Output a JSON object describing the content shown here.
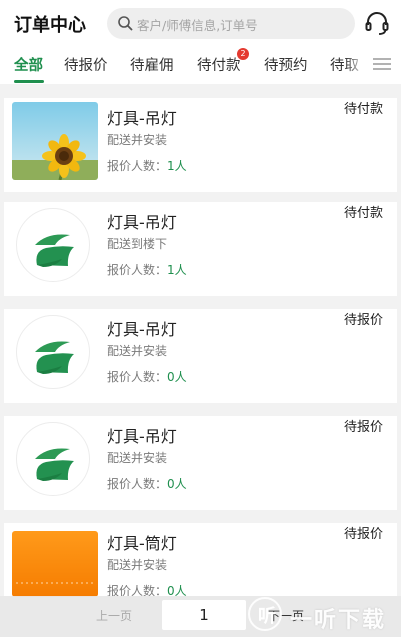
{
  "header": {
    "title": "订单中心",
    "search_placeholder": "客户/师傅信息,订单号"
  },
  "tabs": [
    {
      "label": "全部",
      "active": true
    },
    {
      "label": "待报价"
    },
    {
      "label": "待雇佣"
    },
    {
      "label": "待付款",
      "badge": "2"
    },
    {
      "label": "待预约"
    },
    {
      "label": "待取"
    }
  ],
  "quote_label": "报价人数：",
  "orders": [
    {
      "name": "灯具-吊灯",
      "service": "配送并安装",
      "quote_count": "1人",
      "status": "待付款",
      "thumb": "sunflower-photo"
    },
    {
      "name": "灯具-吊灯",
      "service": "配送到楼下",
      "quote_count": "1人",
      "status": "待付款",
      "thumb": "app-logo"
    },
    {
      "name": "灯具-吊灯",
      "service": "配送并安装",
      "quote_count": "0人",
      "status": "待报价",
      "thumb": "app-logo"
    },
    {
      "name": "灯具-吊灯",
      "service": "配送并安装",
      "quote_count": "0人",
      "status": "待报价",
      "thumb": "app-logo"
    },
    {
      "name": "灯具-筒灯",
      "service": "配送并安装",
      "quote_count": "0人",
      "status": "待报价",
      "thumb": "orange-product-photo"
    }
  ],
  "pager": {
    "prev_label": "上一页",
    "current_page": "1",
    "next_label": "下一页"
  },
  "watermark": {
    "mark": "听",
    "text": "一听下载"
  },
  "colors": {
    "accent": "#1f8f4e",
    "badge": "#e43a30"
  }
}
